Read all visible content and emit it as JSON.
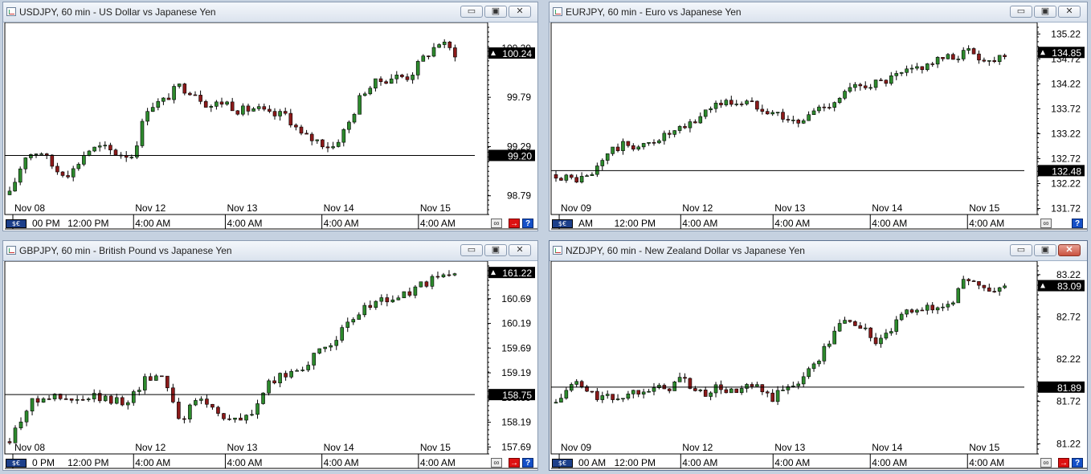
{
  "windows": [
    {
      "id": "usdjpy",
      "title": "USDJPY, 60 min - US Dollar vs Japanese Yen",
      "active": false,
      "chart_data": {
        "type": "candlestick",
        "symbol": "USDJPY",
        "timeframe": "60 min",
        "y_ticks": [
          "100.29",
          "99.79",
          "99.29",
          "98.79"
        ],
        "ylim": [
          98.6,
          100.55
        ],
        "price_tag": "100.24",
        "hline_value": 99.2,
        "hline_label": "99.20",
        "date_labels": [
          "Nov 08",
          "Nov 12",
          "Nov 13",
          "Nov 14",
          "Nov 15"
        ],
        "time_labels": [
          "00 PM",
          "12:00 PM",
          "4:00 AM",
          "4:00 AM",
          "4:00 AM",
          "4:00 AM"
        ],
        "close_path": [
          98.8,
          99.2,
          99.25,
          99.05,
          99.02,
          99.25,
          99.28,
          99.22,
          99.2,
          99.7,
          99.75,
          99.9,
          99.85,
          99.7,
          99.75,
          99.65,
          99.68,
          99.6,
          99.62,
          99.4,
          99.35,
          99.28,
          99.5,
          99.85,
          99.95,
          100.0,
          100.0,
          100.2,
          100.35,
          100.24
        ]
      }
    },
    {
      "id": "eurjpy",
      "title": "EURJPY, 60 min - Euro vs Japanese Yen",
      "active": false,
      "chart_data": {
        "type": "candlestick",
        "symbol": "EURJPY",
        "timeframe": "60 min",
        "y_ticks": [
          "135.22",
          "134.72",
          "134.22",
          "133.72",
          "133.22",
          "132.72",
          "132.22",
          "131.72"
        ],
        "ylim": [
          131.6,
          135.45
        ],
        "price_tag": "134.85",
        "hline_value": 132.48,
        "hline_label": "132.48",
        "date_labels": [
          "Nov 09",
          "Nov 12",
          "Nov 13",
          "Nov 14",
          "Nov 15"
        ],
        "time_labels": [
          "AM",
          "12:00 PM",
          "4:00 AM",
          "4:00 AM",
          "4:00 AM",
          "4:00 AM"
        ],
        "close_path": [
          132.4,
          132.3,
          132.35,
          132.85,
          133.0,
          132.95,
          133.15,
          133.25,
          133.45,
          133.8,
          133.85,
          133.85,
          133.75,
          133.6,
          133.4,
          133.7,
          133.85,
          134.1,
          134.22,
          134.25,
          134.4,
          134.55,
          134.68,
          134.75,
          134.9,
          134.65,
          134.85
        ]
      }
    },
    {
      "id": "gbpjpy",
      "title": "GBPJPY, 60 min - British Pound vs Japanese Yen",
      "active": false,
      "chart_data": {
        "type": "candlestick",
        "symbol": "GBPJPY",
        "timeframe": "60 min",
        "y_ticks": [
          "160.69",
          "160.19",
          "159.69",
          "159.19",
          "158.69",
          "158.19",
          "157.69"
        ],
        "ylim": [
          157.55,
          161.45
        ],
        "price_tag": "161.22",
        "hline_value": 158.75,
        "hline_label": "158.75",
        "date_labels": [
          "Nov 08",
          "Nov 12",
          "Nov 13",
          "Nov 14",
          "Nov 15"
        ],
        "time_labels": [
          "0 PM",
          "12:00 PM",
          "4:00 AM",
          "4:00 AM",
          "4:00 AM",
          "4:00 AM"
        ],
        "close_path": [
          157.8,
          158.5,
          158.75,
          158.65,
          158.6,
          158.7,
          158.6,
          158.65,
          159.1,
          159.15,
          158.2,
          158.7,
          158.45,
          158.2,
          158.3,
          158.9,
          159.15,
          159.3,
          159.55,
          159.9,
          160.2,
          160.6,
          160.65,
          160.75,
          160.95,
          161.1,
          161.22
        ]
      }
    },
    {
      "id": "nzdjpy",
      "title": "NZDJPY, 60 min - New Zealand Dollar vs Japanese Yen",
      "active": true,
      "chart_data": {
        "type": "candlestick",
        "symbol": "NZDJPY",
        "timeframe": "60 min",
        "y_ticks": [
          "83.22",
          "82.72",
          "82.22",
          "81.72",
          "81.22"
        ],
        "ylim": [
          81.1,
          83.38
        ],
        "price_tag": "83.09",
        "hline_value": 81.89,
        "hline_label": "81.89",
        "date_labels": [
          "Nov 09",
          "Nov 12",
          "Nov 13",
          "Nov 14",
          "Nov 15"
        ],
        "time_labels": [
          "00 AM",
          "12:00 PM",
          "4:00 AM",
          "4:00 AM",
          "4:00 AM",
          "4:00 AM"
        ],
        "close_path": [
          81.7,
          81.95,
          81.8,
          81.75,
          81.8,
          81.9,
          81.85,
          82.0,
          81.8,
          81.88,
          81.82,
          81.9,
          81.75,
          81.9,
          82.05,
          82.35,
          82.7,
          82.6,
          82.4,
          82.65,
          82.85,
          82.8,
          82.9,
          83.2,
          83.0,
          83.09
        ]
      }
    }
  ],
  "controls": {
    "minimize_label": "▭",
    "restore_label": "▣",
    "close_label": "✕"
  },
  "corner": {
    "badge_label": "$€",
    "help_label": "?",
    "arrow_label": "→",
    "link_label": "∞"
  },
  "colors": {
    "bull": "#2d8a2d",
    "bear": "#8b1a1a",
    "axis": "#000000",
    "tag_bg": "#000000",
    "tag_fg": "#ffffff"
  }
}
